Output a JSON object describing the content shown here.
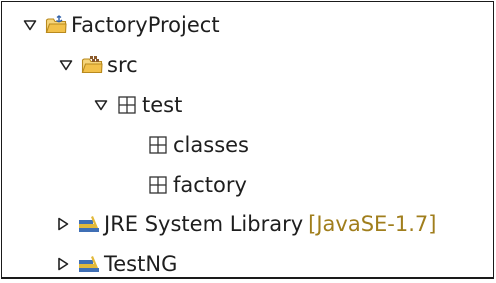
{
  "tree": {
    "project": {
      "label": "FactoryProject",
      "expanded": true,
      "icon": "java-project-folder-icon"
    },
    "src": {
      "label": "src",
      "expanded": true,
      "icon": "source-folder-icon"
    },
    "package_test": {
      "label": "test",
      "expanded": true,
      "icon": "package-icon"
    },
    "package_classes": {
      "label": "classes",
      "icon": "package-icon"
    },
    "package_factory": {
      "label": "factory",
      "icon": "package-icon"
    },
    "jre": {
      "label": "JRE System Library",
      "decoration": "[JavaSE-1.7]",
      "expanded": false,
      "icon": "library-icon"
    },
    "testng": {
      "label": "TestNG",
      "expanded": false,
      "icon": "library-icon"
    }
  },
  "colors": {
    "decoration": "#a07e1c",
    "folder": "#e8b53c",
    "library_books": "#3f6fb5",
    "text": "#1e1e1e"
  }
}
